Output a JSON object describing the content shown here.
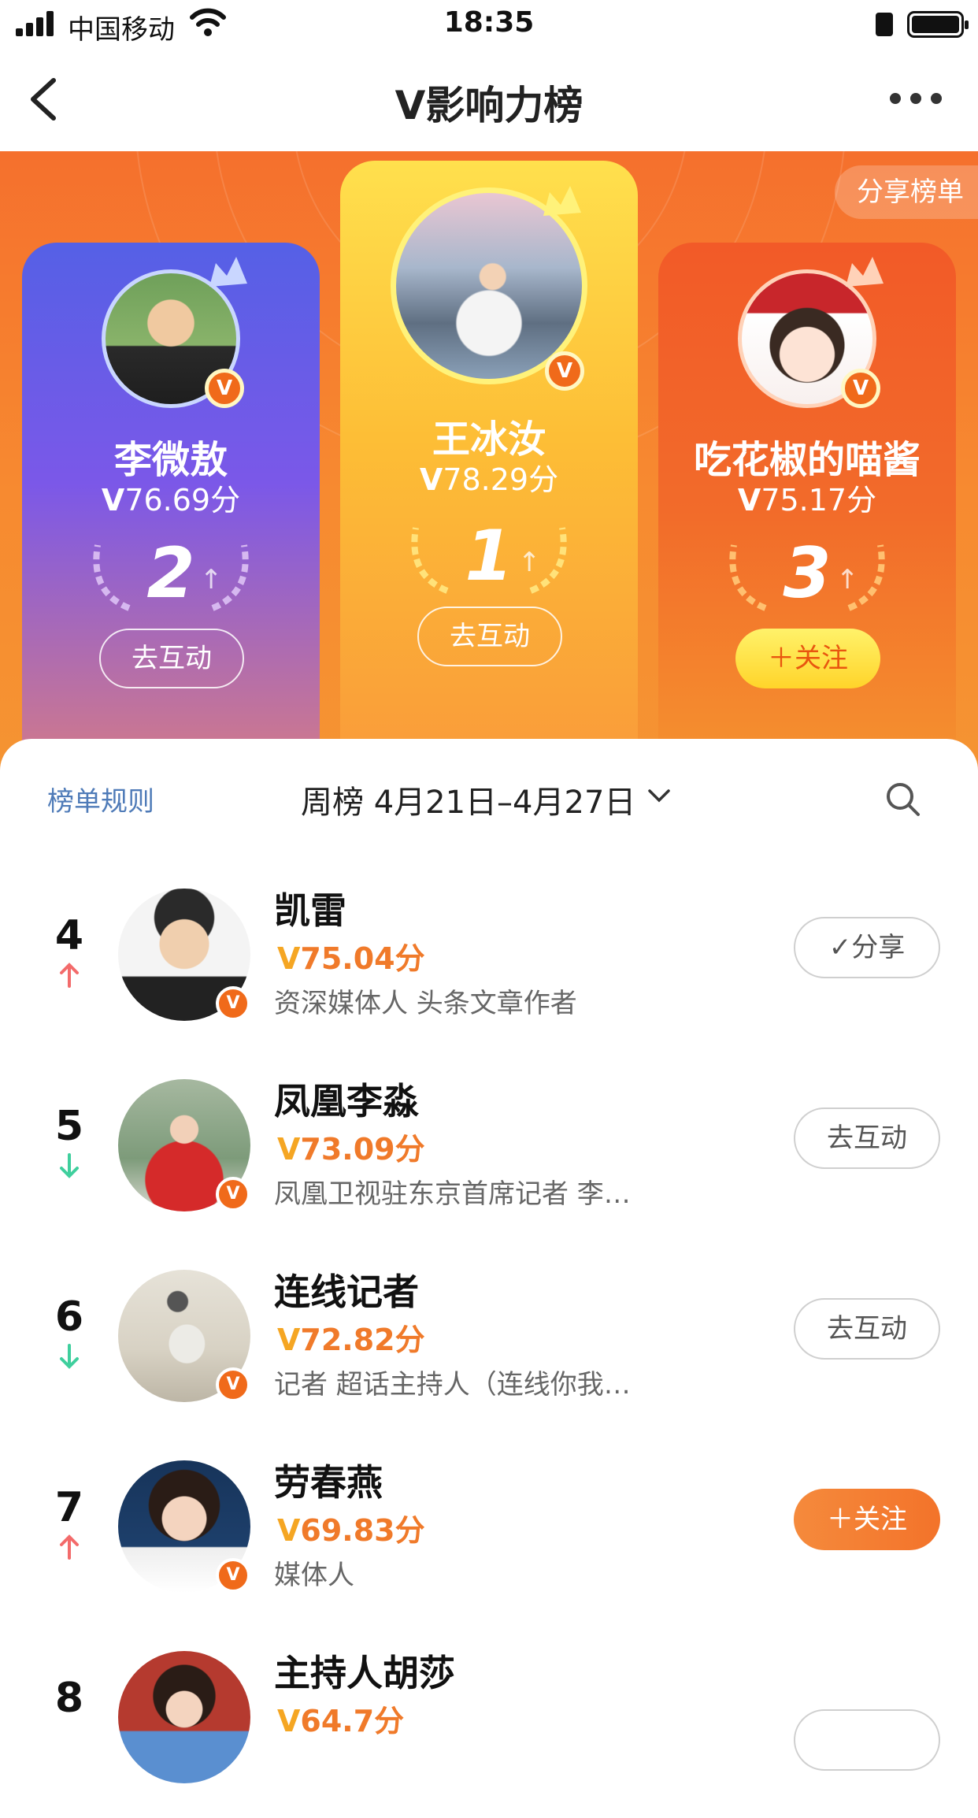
{
  "status_bar": {
    "carrier": "中国移动",
    "time": "18:35"
  },
  "nav": {
    "title": "V影响力榜",
    "back_icon": "chevron-left-icon",
    "more_icon": "more-dots-icon"
  },
  "hero": {
    "share_label": "分享榜单",
    "cards": [
      {
        "rank": "2",
        "name": "李微敖",
        "score": "76.69分",
        "button": "去互动"
      },
      {
        "rank": "1",
        "name": "王冰汝",
        "score": "78.29分",
        "button": "去互动"
      },
      {
        "rank": "3",
        "name": "吃花椒的喵酱",
        "score": "75.17分",
        "button": "＋关注"
      }
    ]
  },
  "list_header": {
    "rules": "榜单规则",
    "period": "周榜  4月21日–4月27日"
  },
  "rows": [
    {
      "rank": "4",
      "trend": "up",
      "name": "凯雷",
      "score": "75.04分",
      "desc": "资深媒体人 头条文章作者",
      "button": "✓分享"
    },
    {
      "rank": "5",
      "trend": "down",
      "name": "凤凰李淼",
      "score": "73.09分",
      "desc": "凤凰卫视驻东京首席记者 李…",
      "button": "去互动"
    },
    {
      "rank": "6",
      "trend": "down",
      "name": "连线记者",
      "score": "72.82分",
      "desc": "记者 超话主持人（连线你我…",
      "button": "去互动"
    },
    {
      "rank": "7",
      "trend": "up",
      "name": "劳春燕",
      "score": "69.83分",
      "desc": "媒体人",
      "button": "＋关注"
    },
    {
      "rank": "8",
      "trend": "",
      "name": "主持人胡莎",
      "score": "64.7分",
      "desc": "",
      "button": ""
    }
  ],
  "colors": {
    "accent": "#f5702d",
    "score": "#f07a2a",
    "up": "#f36b6b",
    "down": "#3fcf9d",
    "link": "#4f7bb8"
  }
}
